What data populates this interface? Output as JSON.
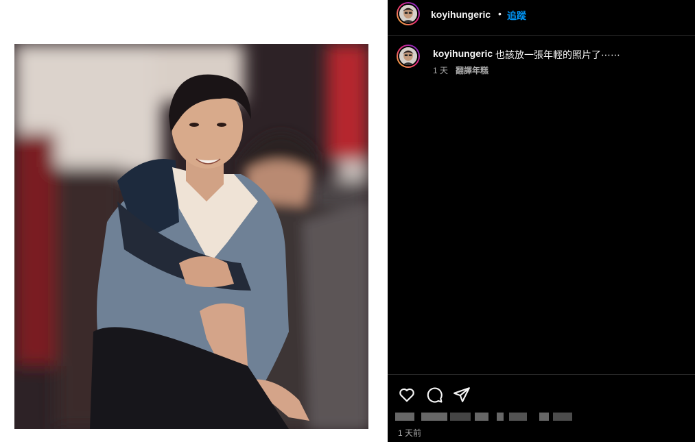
{
  "post": {
    "username": "koyihungeric",
    "follow_label": "追蹤",
    "separator": "•"
  },
  "caption": {
    "username": "koyihungeric",
    "text": "也該放一張年輕的照片了⋯⋯",
    "time": "1 天",
    "translate_label": "翻譯年糕"
  },
  "footer": {
    "time_ago": "1 天前",
    "icons": [
      "heart-icon",
      "comment-icon",
      "share-icon"
    ]
  },
  "colors": {
    "accent": "#0095f6",
    "background": "#000000",
    "muted_text": "#a8a8a8"
  }
}
